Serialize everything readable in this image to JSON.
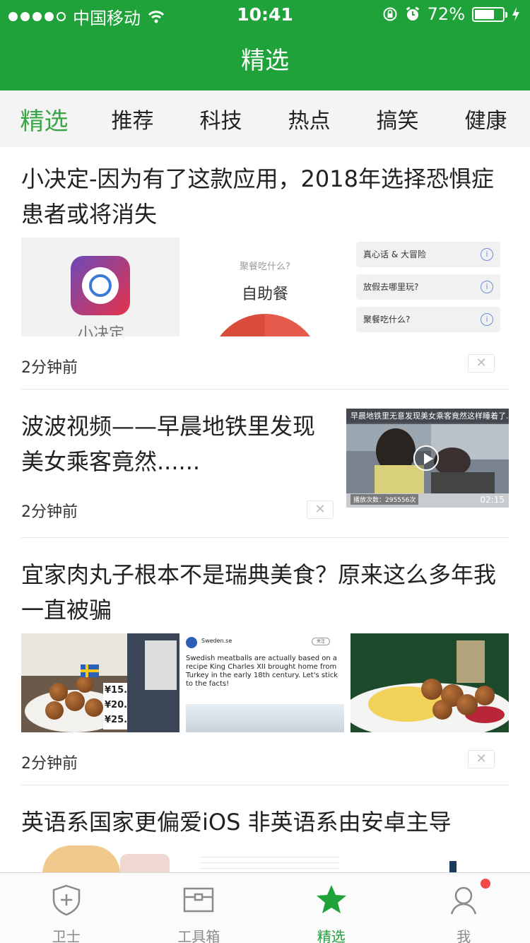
{
  "status_bar": {
    "carrier": "中国移动",
    "time": "10:41",
    "battery_percent": "72%",
    "battery_level": 0.72,
    "signal_bars": 4,
    "icons": [
      "wifi-icon",
      "orientation-lock-icon",
      "alarm-icon",
      "battery-icon",
      "charging-icon"
    ]
  },
  "header": {
    "title": "精选"
  },
  "tabs": [
    {
      "label": "精选",
      "active": true
    },
    {
      "label": "推荐"
    },
    {
      "label": "科技"
    },
    {
      "label": "热点"
    },
    {
      "label": "搞笑"
    },
    {
      "label": "健康"
    }
  ],
  "articles": [
    {
      "title": "小决定-因为有了这款应用，2018年选择恐惧症患者或将消失",
      "time": "2分钟前",
      "thumbs": {
        "app_name": "小决定",
        "wheel_question": "聚餐吃什么?",
        "wheel_answer": "自助餐",
        "menu_items": [
          "真心话 & 大冒险",
          "放假去哪里玩?",
          "聚餐吃什么?"
        ]
      }
    },
    {
      "title": "波波视频——早晨地铁里发现美女乘客竟然......",
      "time": "2分钟前",
      "video": {
        "caption": "早晨地铁里无意发现美女乘客竟然这样睡着了...",
        "play_count": "播放次数：295556次",
        "duration": "02:15"
      }
    },
    {
      "title": "宜家肉丸子根本不是瑞典美食？原来这么多年我一直被骗",
      "time": "2分钟前",
      "thumbs": {
        "price_tags": [
          "¥15.",
          "¥20.",
          "¥25."
        ],
        "tweet_handle": "Sweden.se",
        "tweet_follow": "关注",
        "tweet_text": "Swedish meatballs are actually based on a recipe King Charles XII brought home from Turkey in the early 18th century. Let's stick to the facts!"
      }
    },
    {
      "title": "英语系国家更偏爱iOS 非英语系由安卓主导"
    }
  ],
  "tabbar": [
    {
      "label": "卫士",
      "icon": "shield-plus-icon"
    },
    {
      "label": "工具箱",
      "icon": "toolbox-icon"
    },
    {
      "label": "精选",
      "icon": "star-icon",
      "active": true
    },
    {
      "label": "我",
      "icon": "user-icon",
      "badge": true
    }
  ],
  "colors": {
    "brand_green": "#1fa23a",
    "active_tab_green": "#3aa545",
    "badge_red": "#f0494a"
  }
}
